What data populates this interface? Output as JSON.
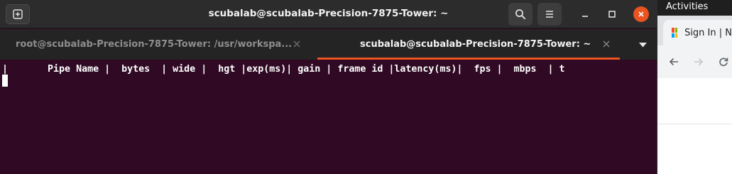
{
  "terminal": {
    "title": "scubalab@scubalab-Precision-7875-Tower: ~",
    "tabs": [
      {
        "label": "root@scubalab-Precision-7875-Tower: /usr/workspa...",
        "active": false
      },
      {
        "label": "scubalab@scubalab-Precision-7875-Tower: ~",
        "active": true
      }
    ],
    "header_line": "|       Pipe Name |  bytes  | wide |  hgt |exp(ms)| gain | frame id |latency(ms)|  fps |  mbps  | t",
    "icons": {
      "new_tab": "new-tab-icon",
      "search": "search-icon",
      "menu": "hamburger-menu-icon",
      "minimize": "minimize-icon",
      "maximize": "maximize-icon",
      "close": "close-icon",
      "tab_list": "chevron-down-icon"
    },
    "colors": {
      "background": "#300a24",
      "accent": "#e95420",
      "text": "#ffffff"
    }
  },
  "desktop": {
    "activities_label": "Activities"
  },
  "browser": {
    "tab_title": "Sign In | N",
    "icons": {
      "back": "back-arrow-icon",
      "forward": "forward-arrow-icon",
      "reload": "reload-icon",
      "favicon": "microsoft-logo-icon"
    }
  }
}
